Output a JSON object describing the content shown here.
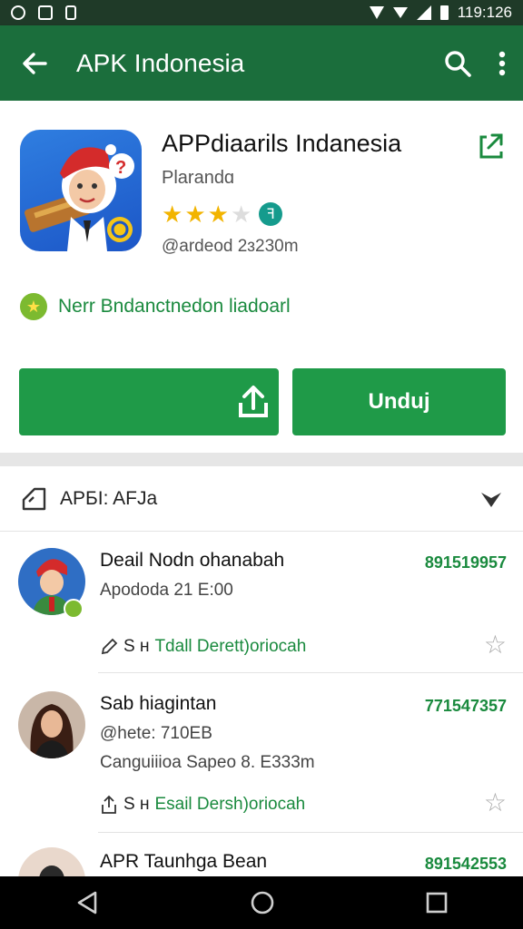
{
  "status_bar": {
    "time": "119:126"
  },
  "app_bar": {
    "title": "APK Indonesia"
  },
  "app": {
    "name": "APPdiaarils Indanesia",
    "developer": "Plarandɑ",
    "rating": 3,
    "rating_max": 5,
    "badge": "ꟻ",
    "meta": "@ardeod 2ɜ230m",
    "notice": "Nerr Bndanctnedon liadoarl",
    "install_label": "",
    "download_label": "Unduj"
  },
  "section": {
    "title": "APБI: AFJa"
  },
  "reviews": [
    {
      "name": "Deail Nodn ohanabah",
      "sub": "Apododa 21 E:00",
      "sub2": "",
      "number": "891519957",
      "link_prefix": "S ʜ",
      "link_text": "Tdall Derett)oriocah"
    },
    {
      "name": "Sab hiagintan",
      "sub": "@hete: 710EB",
      "sub2": "Canguiiioa Sapeo 8. E333m",
      "number": "771547357",
      "link_prefix": "S ʜ",
      "link_text": "Esail Dersh)oriocah"
    },
    {
      "name": "APR Taunhga Bean",
      "sub": "",
      "sub2": "",
      "number": "891542553",
      "link_prefix": "",
      "link_text": ""
    }
  ],
  "colors": {
    "appbar": "#1b6e3c",
    "accent": "#1f9a48",
    "star": "#f2b400"
  }
}
